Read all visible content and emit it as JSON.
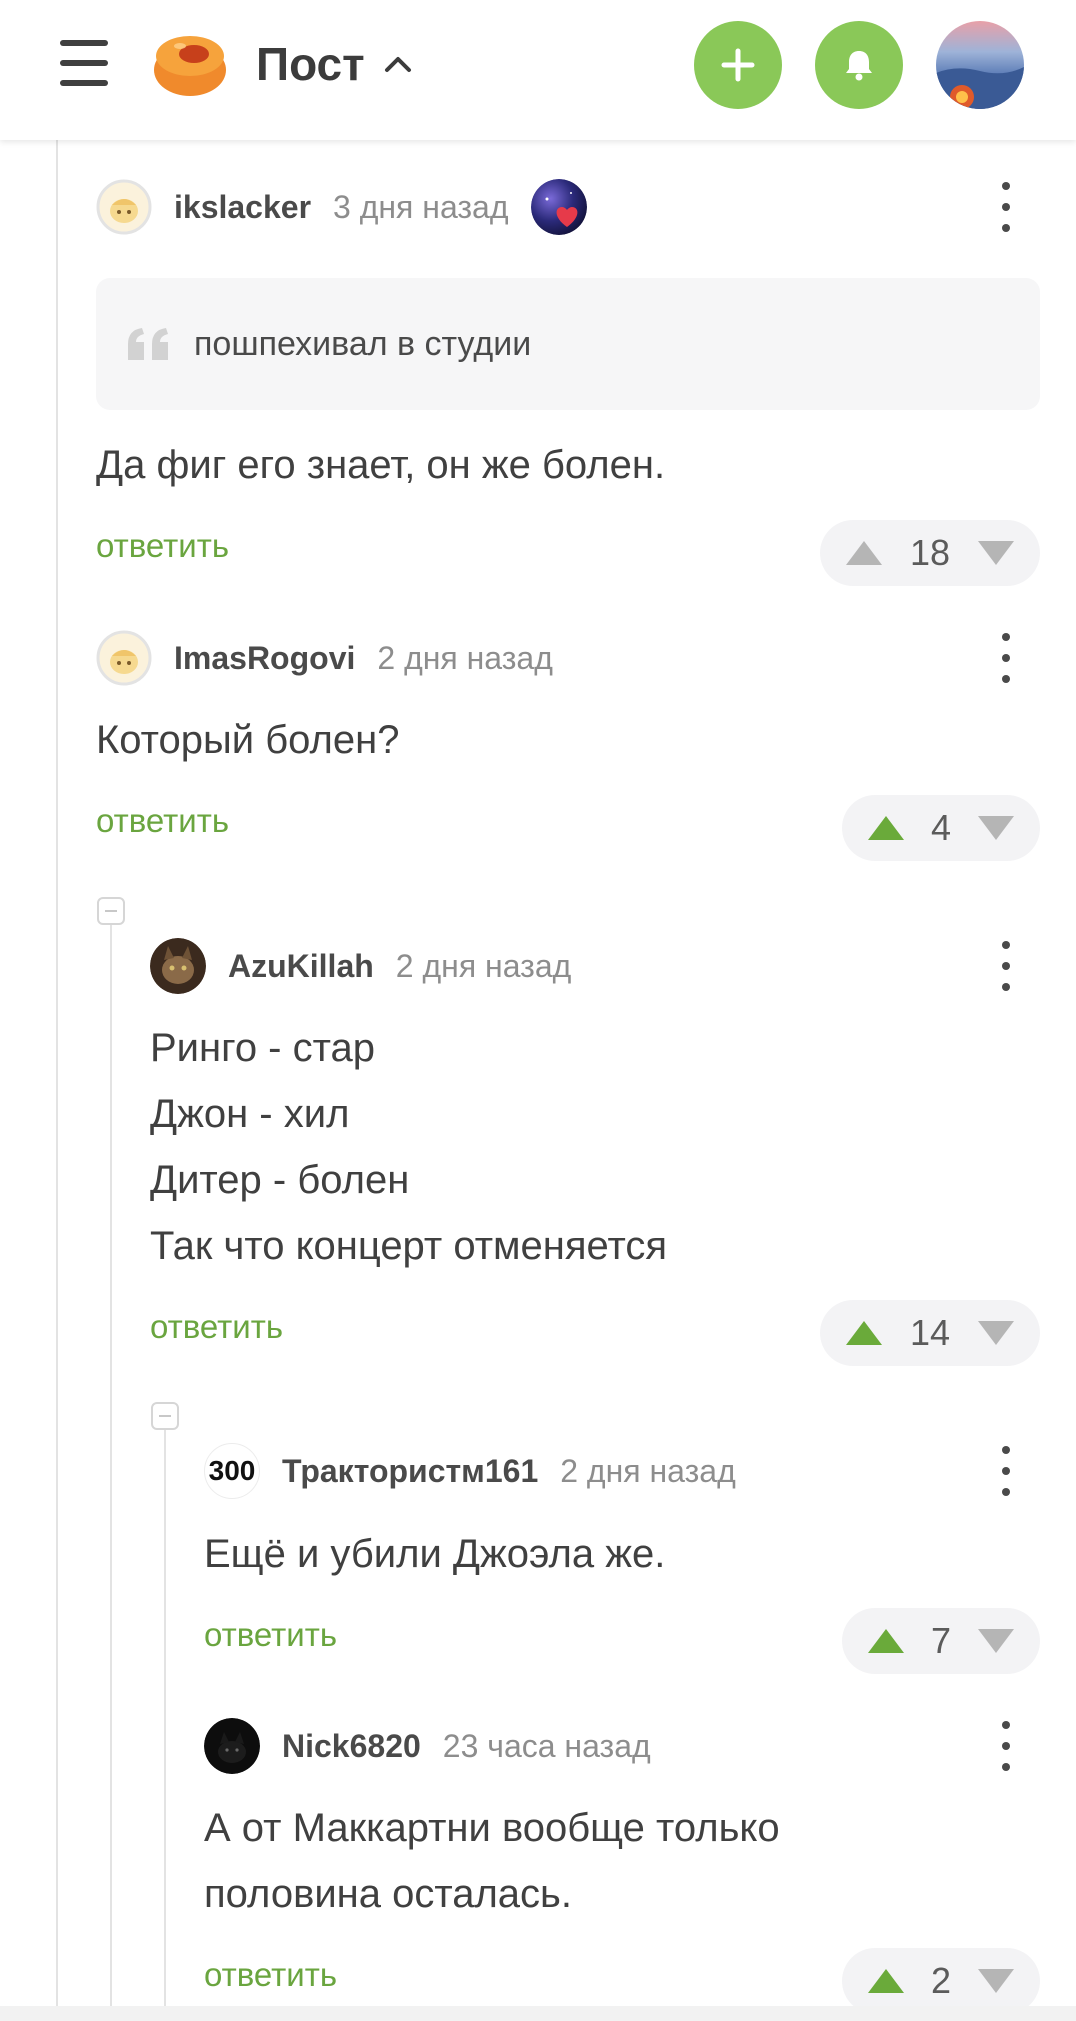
{
  "header": {
    "title": "Пост"
  },
  "comments": [
    {
      "username": "ikslacker",
      "time": "3 дня назад",
      "quote": "пошпехивал в студии",
      "lines": [
        "Да фиг его знает, он же болен."
      ],
      "reply": "ответить",
      "score": "18",
      "vote_state": "none"
    },
    {
      "username": "ImasRogovi",
      "time": "2 дня назад",
      "lines": [
        "Который болен?"
      ],
      "reply": "ответить",
      "score": "4",
      "vote_state": "up"
    },
    {
      "username": "AzuKillah",
      "time": "2 дня назад",
      "lines": [
        "Ринго - стар",
        "Джон - хил",
        "Дитер - болен",
        "Так что концерт отменяется"
      ],
      "reply": "ответить",
      "score": "14",
      "vote_state": "up"
    },
    {
      "username": "Трактористм161",
      "time": "2 дня назад",
      "avatar_text": "300",
      "lines": [
        "Ещё и убили Джоэла же."
      ],
      "reply": "ответить",
      "score": "7",
      "vote_state": "up"
    },
    {
      "username": "Nick6820",
      "time": "23 часа назад",
      "lines": [
        "А от Маккартни вообще только",
        "половина осталась."
      ],
      "reply": "ответить",
      "score": "2",
      "vote_state": "up"
    }
  ],
  "colors": {
    "accent_green": "#8ac858",
    "link_green": "#6aa53f",
    "vote_gray": "#b5b5b5"
  }
}
